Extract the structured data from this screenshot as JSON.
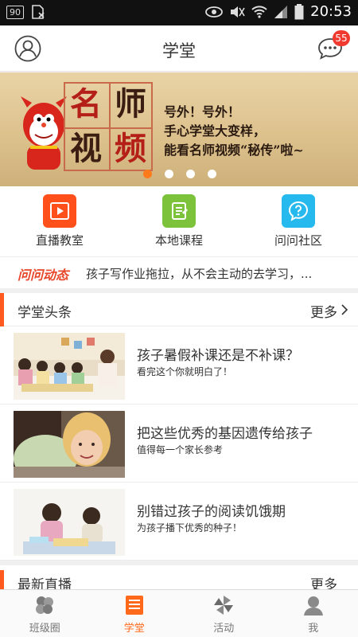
{
  "status_bar": {
    "notification_badge": "90",
    "time": "20:53"
  },
  "header": {
    "title": "学堂",
    "message_count": "55"
  },
  "banner": {
    "grid_chars": [
      "名",
      "师",
      "视",
      "频"
    ],
    "slogan_lines": [
      "号外！号外！",
      "手心学堂大变样，",
      "能看名师视频“秘传”啦~"
    ],
    "active_dot": 0,
    "dot_count": 4
  },
  "quick_entries": [
    {
      "label": "直播教室",
      "color": "#ff4f1a",
      "icon": "play-icon"
    },
    {
      "label": "本地课程",
      "color": "#7cc23a",
      "icon": "notebook-icon"
    },
    {
      "label": "问问社区",
      "color": "#25b9ee",
      "icon": "question-icon"
    }
  ],
  "ticker": {
    "tag": "问问动态",
    "text": "孩子写作业拖拉，从不会主动的去学习，..."
  },
  "section": {
    "title": "学堂头条",
    "more": "更多"
  },
  "articles": [
    {
      "title": "孩子暑假补课还是不补课？",
      "subtitle": "看完这个你就明白了！"
    },
    {
      "title": "把这些优秀的基因遗传给孩子",
      "subtitle": "值得每一个家长参考"
    },
    {
      "title": "别错过孩子的阅读饥饿期",
      "subtitle": "为孩子播下优秀的种子！"
    }
  ],
  "section2": {
    "title": "最新直播",
    "more": "更多"
  },
  "tabs": [
    {
      "label": "班级圈",
      "icon": "class-circle-icon"
    },
    {
      "label": "学堂",
      "icon": "school-icon"
    },
    {
      "label": "活动",
      "icon": "pinwheel-icon"
    },
    {
      "label": "我",
      "icon": "profile-icon"
    }
  ],
  "active_tab": 1,
  "colors": {
    "accent": "#ff6a1a",
    "badge": "#f03a30"
  }
}
